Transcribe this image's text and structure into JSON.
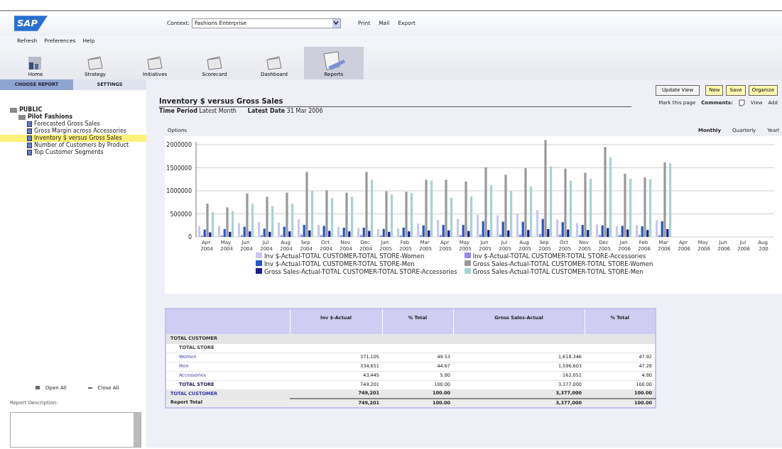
{
  "header": {
    "logo": "SAP",
    "context_label": "Context:",
    "context_value": "Fashions Enterprise",
    "actions": [
      "Print",
      "Mail",
      "Export"
    ]
  },
  "menu": [
    "Refresh",
    "Preferences",
    "Help"
  ],
  "nav": [
    {
      "label": "Home",
      "kind": "home",
      "selected": false
    },
    {
      "label": "Strategy",
      "kind": "folder",
      "selected": false
    },
    {
      "label": "Initiatives",
      "kind": "folder",
      "selected": false
    },
    {
      "label": "Scorecard",
      "kind": "folder",
      "selected": false
    },
    {
      "label": "Dashboard",
      "kind": "folder",
      "selected": false
    },
    {
      "label": "Reports",
      "kind": "reports",
      "selected": true
    }
  ],
  "sidebar": {
    "tabs": [
      {
        "label": "CHOOSE REPORT",
        "selected": true
      },
      {
        "label": "SETTINGS",
        "selected": false
      }
    ],
    "tree": [
      {
        "label": "PUBLIC",
        "children": [
          {
            "label": "Pilot Fashions",
            "children": [
              {
                "label": "Forecasted Gross Sales",
                "selected": false
              },
              {
                "label": "Gross Margin across Accessories",
                "selected": false
              },
              {
                "label": "Inventory $ versus Gross Sales",
                "selected": true
              },
              {
                "label": "Number of Customers by Product",
                "selected": false
              },
              {
                "label": "Top Customer Segments",
                "selected": false
              }
            ]
          }
        ]
      }
    ],
    "open_all": "Open All",
    "close_all": "Close All",
    "description_label": "Report Description:"
  },
  "toolbar": {
    "buttons": [
      {
        "label": "Update View",
        "kind": "plain"
      },
      {
        "label": "New",
        "kind": "yellow"
      },
      {
        "label": "Save",
        "kind": "yellow"
      },
      {
        "label": "Organize",
        "kind": "yellow"
      }
    ],
    "mark_link": "Mark this page",
    "comments_label": "Comments:",
    "comment_links": [
      "View",
      "Add"
    ]
  },
  "report": {
    "title": "Inventory $ versus Gross Sales",
    "filters": [
      {
        "label": "Time Period",
        "value": "Latest Month"
      },
      {
        "label": "Latest Date",
        "value": "31 Mar 2006"
      }
    ],
    "options_link": "Options",
    "periods": [
      {
        "label": "Monthly",
        "selected": true
      },
      {
        "label": "Quarterly",
        "selected": false
      },
      {
        "label": "Yearl",
        "selected": false
      }
    ],
    "chart_data": {
      "type": "bar",
      "categories": [
        "Apr 2004",
        "May 2004",
        "Jun 2004",
        "Jul 2004",
        "Aug 2004",
        "Sep 2004",
        "Oct 2004",
        "Nov 2004",
        "Dec 2004",
        "Jan 2005",
        "Feb 2005",
        "Mar 2005",
        "Apr 2005",
        "May 2005",
        "Jun 2005",
        "Jul 2005",
        "Aug 2005",
        "Sep 2005",
        "Oct 2005",
        "Nov 2005",
        "Dec 2005",
        "Jan 2006",
        "Feb 2006",
        "Mar 2006",
        "Apr 2006",
        "May 2006",
        "Jun 2006",
        "Jul 2006",
        "Aug 200"
      ],
      "ylim": [
        0,
        2200000
      ],
      "grid": true,
      "legend": true,
      "yticks": [
        0,
        500000,
        1000000,
        1500000,
        2000000
      ],
      "series": [
        {
          "name": "Inv $-Actual-TOTAL CUSTOMER-TOTAL STORE-Women",
          "color": "#c8c8ec",
          "values": [
            230000,
            240000,
            300000,
            320000,
            310000,
            380000,
            260000,
            220000,
            190000,
            170000,
            180000,
            290000,
            370000,
            390000,
            480000,
            470000,
            500000,
            580000,
            380000,
            300000,
            270000,
            230000,
            260000,
            360000,
            null,
            null,
            null,
            null,
            null
          ]
        },
        {
          "name": "Inv $-Actual-TOTAL CUSTOMER-TOTAL STORE-Accessories",
          "color": "#9a86e8",
          "values": [
            30000,
            30000,
            40000,
            40000,
            40000,
            50000,
            40000,
            40000,
            40000,
            30000,
            30000,
            40000,
            40000,
            40000,
            50000,
            50000,
            50000,
            60000,
            50000,
            40000,
            40000,
            40000,
            40000,
            40000,
            null,
            null,
            null,
            null,
            null
          ]
        },
        {
          "name": "Inv $-Actual-TOTAL CUSTOMER-TOTAL STORE-Men",
          "color": "#2457c8",
          "values": [
            160000,
            170000,
            220000,
            180000,
            220000,
            260000,
            240000,
            200000,
            200000,
            170000,
            200000,
            250000,
            260000,
            260000,
            340000,
            330000,
            330000,
            390000,
            320000,
            260000,
            250000,
            240000,
            230000,
            340000,
            null,
            null,
            null,
            null,
            null
          ]
        },
        {
          "name": "Gross Sales-Actual-TOTAL CUSTOMER-TOTAL STORE-Women",
          "color": "#999999",
          "values": [
            720000,
            640000,
            940000,
            870000,
            960000,
            1410000,
            1010000,
            960000,
            1410000,
            990000,
            980000,
            1240000,
            1240000,
            1200000,
            1510000,
            1350000,
            1490000,
            2100000,
            1480000,
            1390000,
            1950000,
            1370000,
            1290000,
            1620000,
            null,
            null,
            null,
            null,
            null
          ]
        },
        {
          "name": "Gross Sales-Actual-TOTAL CUSTOMER-TOTAL STORE-Accessories",
          "color": "#1a1a8c",
          "values": [
            100000,
            110000,
            120000,
            110000,
            120000,
            140000,
            130000,
            120000,
            130000,
            110000,
            120000,
            140000,
            140000,
            130000,
            150000,
            140000,
            150000,
            170000,
            160000,
            150000,
            190000,
            160000,
            150000,
            170000,
            null,
            null,
            null,
            null,
            null
          ]
        },
        {
          "name": "Gross Sales-Actual-TOTAL CUSTOMER-TOTAL STORE-Men",
          "color": "#a6d4d4",
          "values": [
            540000,
            560000,
            720000,
            660000,
            720000,
            1000000,
            840000,
            870000,
            1240000,
            920000,
            950000,
            1220000,
            850000,
            880000,
            1120000,
            1000000,
            1090000,
            1530000,
            1220000,
            1260000,
            1730000,
            1260000,
            1250000,
            1600000,
            null,
            null,
            null,
            null,
            null
          ]
        }
      ]
    },
    "table": {
      "columns": [
        "Inv $-Actual",
        "% Total",
        "Gross Sales-Actual",
        "% Total"
      ],
      "rows": [
        {
          "kind": "group",
          "label": "TOTAL CUSTOMER",
          "cells": []
        },
        {
          "kind": "subgroup",
          "label": "TOTAL STORE",
          "cells": []
        },
        {
          "kind": "item",
          "label": "Women",
          "cells": [
            "371,105",
            "49.53",
            "1,618,346",
            "47.92"
          ]
        },
        {
          "kind": "item",
          "label": "Men",
          "cells": [
            "334,651",
            "44.67",
            "1,596,603",
            "47.28"
          ]
        },
        {
          "kind": "item",
          "label": "Accessories",
          "cells": [
            "43,445",
            "5.80",
            "162,051",
            "4.80"
          ]
        },
        {
          "kind": "subtotal",
          "label": "TOTAL STORE",
          "cells": [
            "749,201",
            "100.00",
            "3,377,000",
            "100.00"
          ]
        },
        {
          "kind": "total",
          "label": "TOTAL CUSTOMER",
          "cells": [
            "749,201",
            "100.00",
            "3,377,000",
            "100.00"
          ]
        },
        {
          "kind": "report",
          "label": "Report Total",
          "cells": [
            "749,201",
            "100.00",
            "3,377,000",
            "100.00"
          ]
        }
      ]
    }
  }
}
